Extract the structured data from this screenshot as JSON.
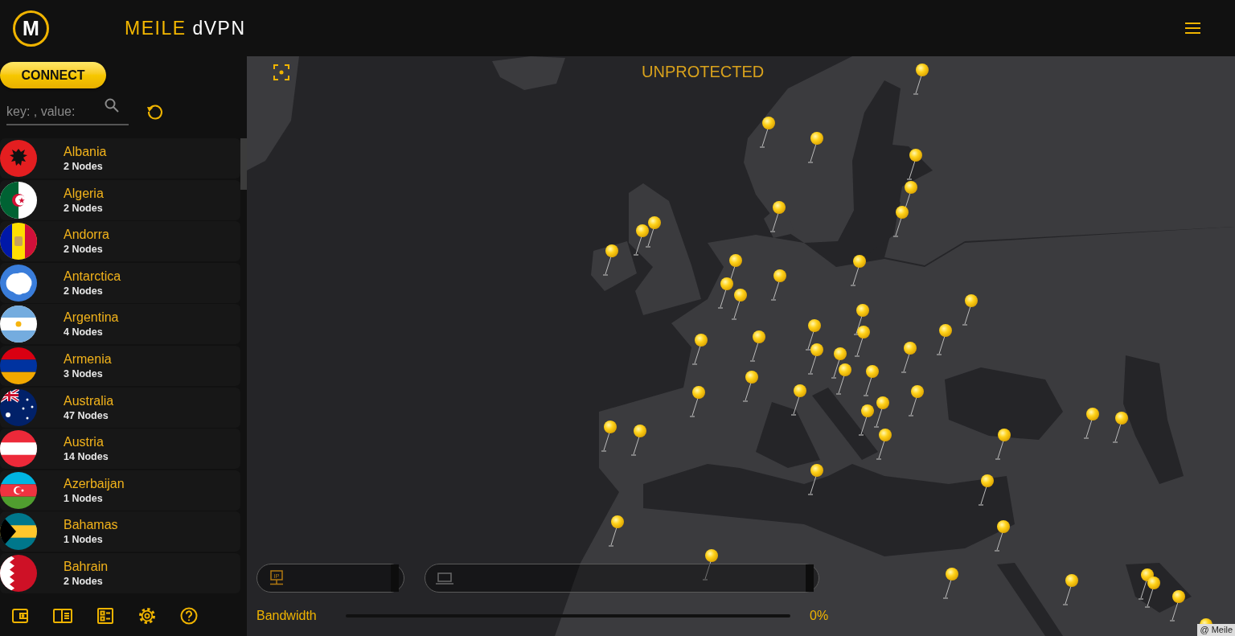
{
  "header": {
    "logo_letter": "M",
    "brand": [
      "MEILE",
      "dVPN"
    ]
  },
  "sidebar": {
    "connect_button": "CONNECT",
    "search": {
      "placeholder": "key: , value:"
    },
    "countries": [
      {
        "name": "Albania",
        "nodes": "2 Nodes"
      },
      {
        "name": "Algeria",
        "nodes": "2 Nodes"
      },
      {
        "name": "Andorra",
        "nodes": "2 Nodes"
      },
      {
        "name": "Antarctica",
        "nodes": "2 Nodes"
      },
      {
        "name": "Argentina",
        "nodes": "4 Nodes"
      },
      {
        "name": "Armenia",
        "nodes": "3 Nodes"
      },
      {
        "name": "Australia",
        "nodes": "47 Nodes"
      },
      {
        "name": "Austria",
        "nodes": "14 Nodes"
      },
      {
        "name": "Azerbaijan",
        "nodes": "1 Nodes"
      },
      {
        "name": "Bahamas",
        "nodes": "1 Nodes"
      },
      {
        "name": "Bahrain",
        "nodes": "2 Nodes"
      }
    ]
  },
  "map": {
    "status": "UNPROTECTED",
    "ip_panel": {
      "icon_text": "IP"
    },
    "bandwidth": {
      "label": "Bandwidth",
      "level": 0,
      "reading": "0%"
    },
    "attribution": "@ Meile"
  }
}
